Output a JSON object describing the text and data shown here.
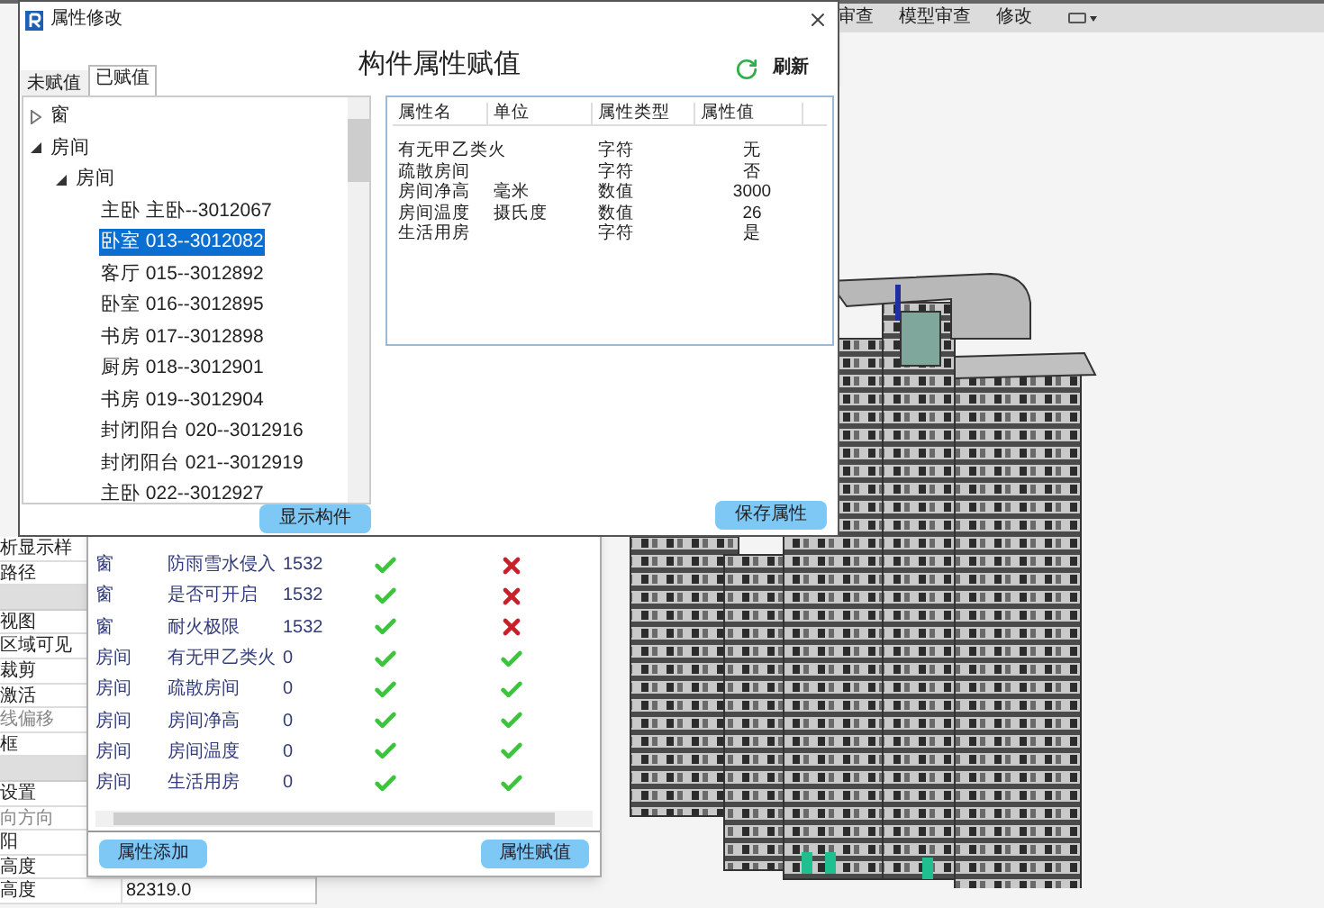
{
  "ribbon": {
    "tabs": [
      "审查",
      "模型审查",
      "修改"
    ]
  },
  "properties_panel": {
    "rows": [
      {
        "kind": "row",
        "label": "析显示样",
        "muted": false
      },
      {
        "kind": "row",
        "label": "路径",
        "muted": false
      },
      {
        "kind": "header"
      },
      {
        "kind": "row",
        "label": "视图",
        "muted": false
      },
      {
        "kind": "row",
        "label": "区域可见",
        "muted": false
      },
      {
        "kind": "row",
        "label": "裁剪",
        "muted": false
      },
      {
        "kind": "row",
        "label": "激活",
        "muted": false
      },
      {
        "kind": "row",
        "label": "线偏移",
        "muted": true
      },
      {
        "kind": "row",
        "label": "框",
        "muted": false
      },
      {
        "kind": "header"
      },
      {
        "kind": "row",
        "label": "设置",
        "muted": false
      },
      {
        "kind": "row",
        "label": "向方向",
        "muted": true
      },
      {
        "kind": "row",
        "label": "阳",
        "muted": false
      },
      {
        "kind": "row",
        "label": "高度",
        "muted": false
      },
      {
        "kind": "row",
        "label": "高度",
        "muted": false,
        "value": "82319.0"
      }
    ]
  },
  "check_dialog": {
    "rows": [
      {
        "category": "窗",
        "property": "防雨雪水侵入",
        "value": "1532",
        "check_1": true,
        "check_2": false
      },
      {
        "category": "窗",
        "property": "是否可开启",
        "value": "1532",
        "check_1": true,
        "check_2": false
      },
      {
        "category": "窗",
        "property": "耐火极限",
        "value": "1532",
        "check_1": true,
        "check_2": false
      },
      {
        "category": "房间",
        "property": "有无甲乙类火",
        "value": "0",
        "check_1": true,
        "check_2": true
      },
      {
        "category": "房间",
        "property": "疏散房间",
        "value": "0",
        "check_1": true,
        "check_2": true
      },
      {
        "category": "房间",
        "property": "房间净高",
        "value": "0",
        "check_1": true,
        "check_2": true
      },
      {
        "category": "房间",
        "property": "房间温度",
        "value": "0",
        "check_1": true,
        "check_2": true
      },
      {
        "category": "房间",
        "property": "生活用房",
        "value": "0",
        "check_1": true,
        "check_2": true
      }
    ],
    "buttons": [
      "属性添加",
      "属性赋值"
    ]
  },
  "dialog": {
    "title": "属性修改",
    "tabs": [
      {
        "label": "未赋值",
        "selected": false
      },
      {
        "label": "已赋值",
        "selected": true
      }
    ],
    "heading": "构件属性赋值",
    "refresh_label": "刷新",
    "tree": [
      {
        "label": "窗",
        "expanded": false,
        "selected": false
      },
      {
        "label": "房间",
        "expanded": true,
        "selected": false,
        "children": [
          {
            "label": "房间",
            "expanded": true,
            "selected": false,
            "children": [
              {
                "label": "主卧 主卧--3012067",
                "selected": false
              },
              {
                "label": "卧室 013--3012082",
                "selected": true
              },
              {
                "label": "客厅 015--3012892",
                "selected": false
              },
              {
                "label": "卧室 016--3012895",
                "selected": false
              },
              {
                "label": "书房 017--3012898",
                "selected": false
              },
              {
                "label": "厨房 018--3012901",
                "selected": false
              },
              {
                "label": "书房 019--3012904",
                "selected": false
              },
              {
                "label": "封闭阳台 020--3012916",
                "selected": false
              },
              {
                "label": "封闭阳台 021--3012919",
                "selected": false
              },
              {
                "label": "主卧 022--3012927",
                "selected": false
              }
            ]
          }
        ]
      }
    ],
    "show_button": "显示构件",
    "table": {
      "columns": [
        "属性名",
        "单位",
        "属性类型",
        "属性值"
      ],
      "rows": [
        [
          "有无甲乙类火",
          "",
          "字符",
          "无"
        ],
        [
          "疏散房间",
          "",
          "字符",
          "否"
        ],
        [
          "房间净高",
          "毫米",
          "数值",
          "3000"
        ],
        [
          "房间温度",
          "摄氏度",
          "数值",
          "26"
        ],
        [
          "生活用房",
          "",
          "字符",
          "是"
        ]
      ]
    },
    "save_button": "保存属性"
  }
}
